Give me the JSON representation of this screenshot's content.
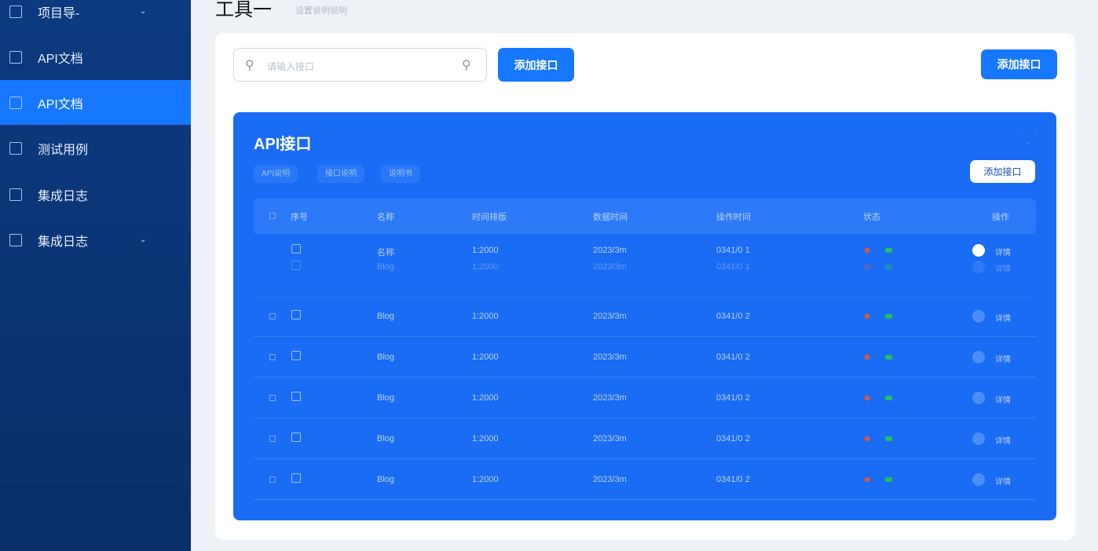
{
  "sidebar": {
    "items": [
      {
        "label": "项目导-",
        "icon": "project-icon",
        "expand": true
      },
      {
        "label": "API文档",
        "icon": "doc-icon"
      },
      {
        "label": "API文档",
        "icon": "mail-icon",
        "active": true
      },
      {
        "label": "测试用例",
        "icon": "test-icon"
      },
      {
        "label": "集成日志",
        "icon": "log-icon"
      },
      {
        "label": "集成日志",
        "icon": "report-icon",
        "expand": true
      }
    ]
  },
  "header": {
    "title": "工具一",
    "subtitle": "设置说明说明"
  },
  "toolbar": {
    "search_placeholder": "请输入接口",
    "add_label": "添加接口",
    "add_right_label": "添加接口"
  },
  "panel": {
    "title": "API接口",
    "chips": [
      "API说明",
      "接口说明",
      "说明书"
    ],
    "add_label": "添加接口",
    "columns": [
      "",
      "序号",
      "名称",
      "时间排版",
      "数据时间",
      "操作时间",
      "状态",
      "操作"
    ],
    "rows": [
      {
        "name": "名称",
        "t1": "1:2000",
        "t2": "2023/3m",
        "t3": "0341/0 1",
        "op": "详情"
      },
      {
        "name": "Blog",
        "t1": "1:2000",
        "t2": "2023/3m",
        "t3": "0341/0 1",
        "op": "详情"
      },
      {
        "name": "Blog",
        "t1": "1:2000",
        "t2": "2023/3m",
        "t3": "0341/0 2",
        "op": "详情"
      },
      {
        "name": "Blog",
        "t1": "1:2000",
        "t2": "2023/3m",
        "t3": "0341/0 2",
        "op": "详情"
      },
      {
        "name": "Blog",
        "t1": "1:2000",
        "t2": "2023/3m",
        "t3": "0341/0 2",
        "op": "详情"
      },
      {
        "name": "Blog",
        "t1": "1:2000",
        "t2": "2023/3m",
        "t3": "0341/0 2",
        "op": "详情"
      },
      {
        "name": "Blog",
        "t1": "1:2000",
        "t2": "2023/3m",
        "t3": "0341/0 2",
        "op": "详情"
      }
    ]
  },
  "colors": {
    "sidebar": "#0c3a80",
    "accent": "#1677ff",
    "panel": "#1a6cf5",
    "status_red": "#e0533d",
    "status_green": "#20c05c"
  }
}
